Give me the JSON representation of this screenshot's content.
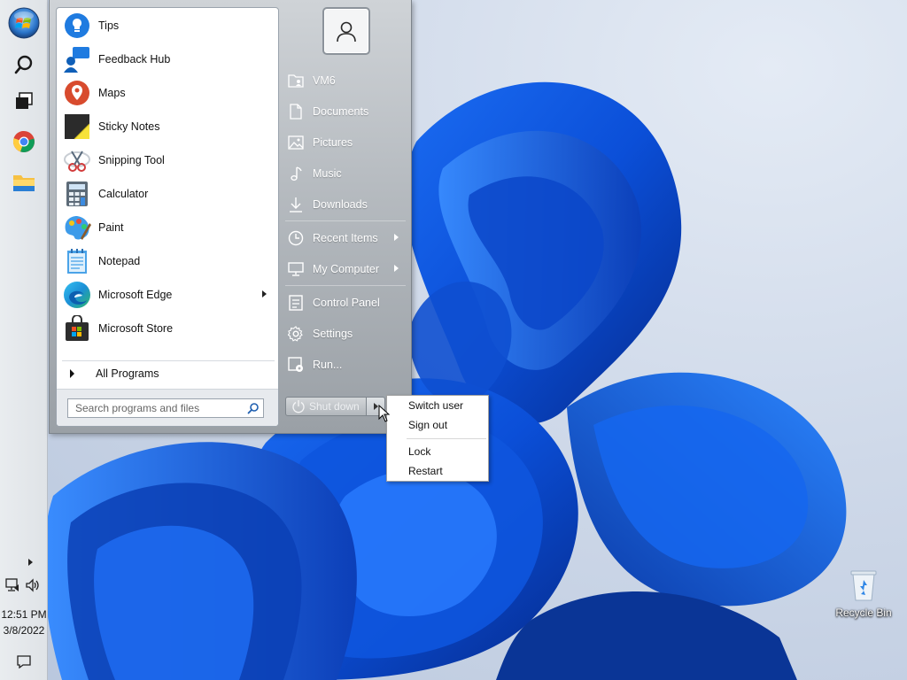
{
  "taskbar": {
    "time": "12:51 PM",
    "date": "3/8/2022"
  },
  "start_menu": {
    "programs": [
      {
        "label": "Tips",
        "icon": "tips-icon"
      },
      {
        "label": "Feedback Hub",
        "icon": "feedback-hub-icon"
      },
      {
        "label": "Maps",
        "icon": "maps-icon"
      },
      {
        "label": "Sticky Notes",
        "icon": "sticky-notes-icon"
      },
      {
        "label": "Snipping Tool",
        "icon": "snipping-tool-icon"
      },
      {
        "label": "Calculator",
        "icon": "calculator-icon"
      },
      {
        "label": "Paint",
        "icon": "paint-icon"
      },
      {
        "label": "Notepad",
        "icon": "notepad-icon"
      },
      {
        "label": "Microsoft Edge",
        "icon": "edge-icon",
        "has_submenu": true
      },
      {
        "label": "Microsoft Store",
        "icon": "store-icon"
      }
    ],
    "all_programs_label": "All Programs",
    "search_placeholder": "Search programs and files",
    "places": [
      {
        "label": "VM6",
        "icon": "user-folder-icon"
      },
      {
        "label": "Documents",
        "icon": "document-icon"
      },
      {
        "label": "Pictures",
        "icon": "picture-icon"
      },
      {
        "label": "Music",
        "icon": "music-note-icon"
      },
      {
        "label": "Downloads",
        "icon": "download-icon"
      },
      {
        "label": "Recent Items",
        "icon": "clock-icon",
        "has_submenu": true
      },
      {
        "label": "My Computer",
        "icon": "computer-icon",
        "has_submenu": true
      },
      {
        "label": "Control Panel",
        "icon": "control-panel-icon"
      },
      {
        "label": "Settings",
        "icon": "gear-icon"
      },
      {
        "label": "Run...",
        "icon": "run-icon"
      }
    ],
    "shutdown_label": "Shut down"
  },
  "shutdown_menu": {
    "items": [
      "Switch user",
      "Sign out",
      "Lock",
      "Restart"
    ]
  },
  "desktop": {
    "recycle_bin_label": "Recycle Bin"
  }
}
